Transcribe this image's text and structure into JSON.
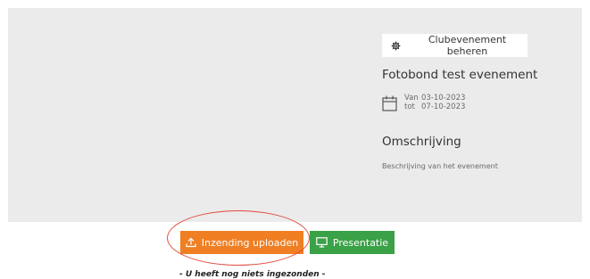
{
  "event_panel": {
    "manage_button_label": "Clubevenement beheren",
    "title": "Fotobond test evenement",
    "date_from_label": "Van",
    "date_from": "03-10-2023",
    "date_to_label": "tot",
    "date_to": "07-10-2023",
    "description_heading": "Omschrijving",
    "description_text": "Beschrijving van het evenement"
  },
  "actions": {
    "upload_label": "Inzending uploaden",
    "presentation_label": "Presentatie"
  },
  "status": {
    "empty_message": "- U heeft nog niets ingezonden -"
  },
  "icons": {
    "manage": "gear-icon",
    "date": "calendar-icon",
    "upload": "upload-icon",
    "presentation": "monitor-icon"
  },
  "colors": {
    "panel_background": "#ebebeb",
    "upload_button": "#f07f24",
    "presentation_button": "#3aa147",
    "highlight": "#e2483b"
  }
}
